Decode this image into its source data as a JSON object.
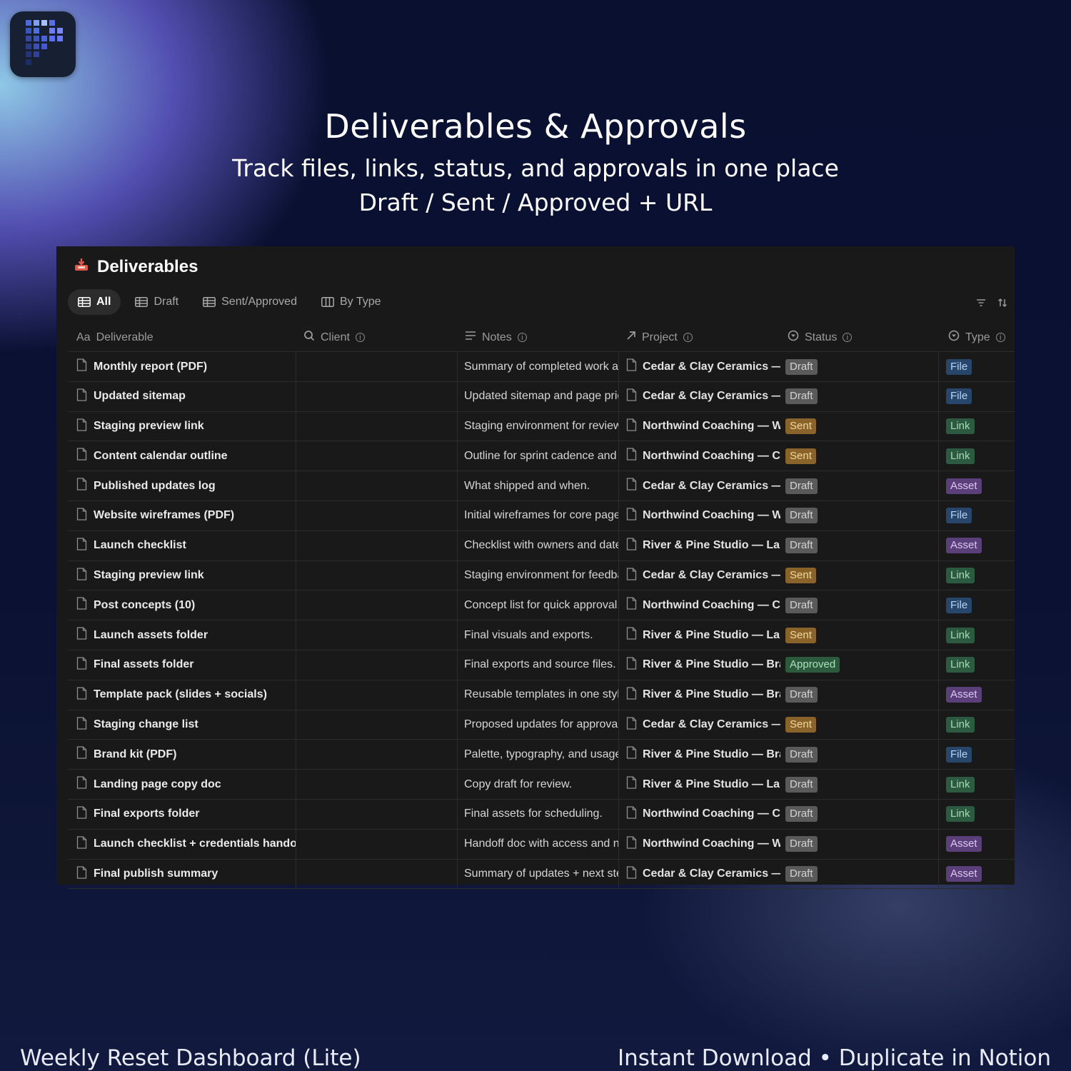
{
  "hero": {
    "title": "Deliverables & Approvals",
    "subtitle1": "Track files, links, status, and approvals in one place",
    "subtitle2": "Draft / Sent / Approved + URL"
  },
  "database": {
    "title": "Deliverables",
    "title_icon": "inbox-tray-icon",
    "views": [
      "All",
      "Draft",
      "Sent/Approved",
      "By Type"
    ],
    "active_view": "All",
    "columns": [
      {
        "label": "Deliverable",
        "icon": "text-icon"
      },
      {
        "label": "Client",
        "icon": "search-icon"
      },
      {
        "label": "Notes",
        "icon": "lines-icon"
      },
      {
        "label": "Project",
        "icon": "arrow-up-right-icon"
      },
      {
        "label": "Status",
        "icon": "status-icon"
      },
      {
        "label": "Type",
        "icon": "select-icon"
      }
    ],
    "rows": [
      {
        "name": "Monthly report (PDF)",
        "notes": "Summary of completed work ar",
        "project": "Cedar & Clay Ceramics — I",
        "status": "Draft",
        "type": "File"
      },
      {
        "name": "Updated sitemap",
        "notes": "Updated sitemap and page pric",
        "project": "Cedar & Clay Ceramics — \\",
        "status": "Draft",
        "type": "File"
      },
      {
        "name": "Staging preview link",
        "notes": "Staging environment for review",
        "project": "Northwind Coaching — W",
        "status": "Sent",
        "type": "Link"
      },
      {
        "name": "Content calendar outline",
        "notes": "Outline for sprint cadence and",
        "project": "Northwind Coaching — Cc",
        "status": "Sent",
        "type": "Link"
      },
      {
        "name": "Published updates log",
        "notes": "What shipped and when.",
        "project": "Cedar & Clay Ceramics — I",
        "status": "Draft",
        "type": "Asset"
      },
      {
        "name": "Website wireframes (PDF)",
        "notes": "Initial wireframes for core page",
        "project": "Northwind Coaching — W",
        "status": "Draft",
        "type": "File"
      },
      {
        "name": "Launch checklist",
        "notes": "Checklist with owners and date",
        "project": "River & Pine Studio — Lau",
        "status": "Draft",
        "type": "Asset"
      },
      {
        "name": "Staging preview link",
        "notes": "Staging environment for feedba",
        "project": "Cedar & Clay Ceramics — \\",
        "status": "Sent",
        "type": "Link"
      },
      {
        "name": "Post concepts (10)",
        "notes": "Concept list for quick approval.",
        "project": "Northwind Coaching — Cc",
        "status": "Draft",
        "type": "File"
      },
      {
        "name": "Launch assets folder",
        "notes": "Final visuals and exports.",
        "project": "River & Pine Studio — Lau",
        "status": "Sent",
        "type": "Link"
      },
      {
        "name": "Final assets folder",
        "notes": "Final exports and source files.",
        "project": "River & Pine Studio — Brar",
        "status": "Approved",
        "type": "Link"
      },
      {
        "name": "Template pack (slides + socials)",
        "notes": "Reusable templates in one style",
        "project": "River & Pine Studio — Brar",
        "status": "Draft",
        "type": "Asset"
      },
      {
        "name": "Staging change list",
        "notes": "Proposed updates for approval",
        "project": "Cedar & Clay Ceramics — I",
        "status": "Sent",
        "type": "Link"
      },
      {
        "name": "Brand kit (PDF)",
        "notes": "Palette, typography, and usage",
        "project": "River & Pine Studio — Brar",
        "status": "Draft",
        "type": "File"
      },
      {
        "name": "Landing page copy doc",
        "notes": "Copy draft for review.",
        "project": "River & Pine Studio — Lau",
        "status": "Draft",
        "type": "Link"
      },
      {
        "name": "Final exports folder",
        "notes": "Final assets for scheduling.",
        "project": "Northwind Coaching — Cc",
        "status": "Draft",
        "type": "Link"
      },
      {
        "name": "Launch checklist + credentials handoff",
        "notes": "Handoff doc with access and ne",
        "project": "Northwind Coaching — W",
        "status": "Draft",
        "type": "Asset"
      },
      {
        "name": "Final publish summary",
        "notes": "Summary of updates + next ste",
        "project": "Cedar & Clay Ceramics — \\",
        "status": "Draft",
        "type": "Asset"
      }
    ]
  },
  "footer": {
    "left": "Weekly Reset Dashboard (Lite)",
    "right": "Instant Download • Duplicate in  Notion"
  },
  "colors": {
    "panel_bg": "#191919",
    "draft": "#5a5a5a",
    "sent": "#89632a",
    "approved": "#2c5a3d",
    "file": "#28456c",
    "link": "#2b5a40",
    "asset": "#5a3f7a"
  }
}
